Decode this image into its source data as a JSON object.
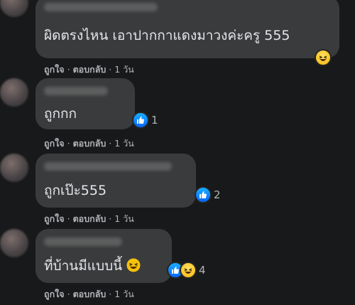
{
  "comments": [
    {
      "text": "ผิดตรงไหน เอาปากกาแดงมาวงค่ะครู 555",
      "reaction_count": "",
      "actions": {
        "like": "ถูกใจ",
        "reply": "ตอบกลับ",
        "time": "1 วัน"
      }
    },
    {
      "text": "ถูกกก",
      "reaction_count": "1",
      "actions": {
        "like": "ถูกใจ",
        "reply": "ตอบกลับ",
        "time": "1 วัน"
      }
    },
    {
      "text": "ถูกเป๊ะ555",
      "reaction_count": "2",
      "actions": {
        "like": "ถูกใจ",
        "reply": "ตอบกลับ",
        "time": "1 วัน"
      }
    },
    {
      "text": "ที่บ้านมีแบบนี้",
      "reaction_count": "4",
      "actions": {
        "like": "ถูกใจ",
        "reply": "ตอบกลับ",
        "time": "1 วัน"
      }
    }
  ],
  "separator": "·",
  "colors": {
    "background": "#18191a",
    "bubble": "#3a3b3c",
    "text": "#e4e6eb",
    "meta": "#b0b3b8",
    "like_blue": "#0866ff",
    "haha_yellow": "#f4b400"
  },
  "icons": [
    "haha-emoji-icon",
    "like-reaction-icon",
    "haha-reaction-icon"
  ]
}
